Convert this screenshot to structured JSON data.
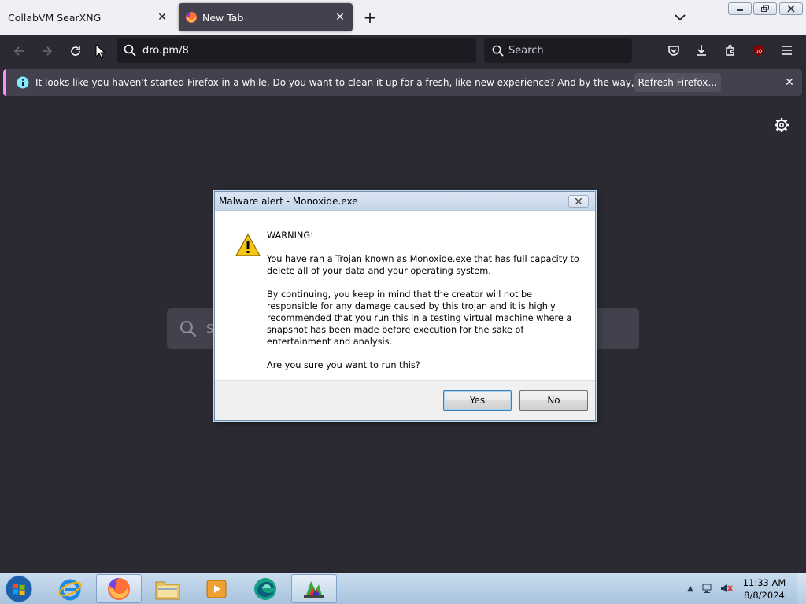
{
  "browser": {
    "tabs": [
      {
        "label": "CollabVM SearXNG",
        "active": false
      },
      {
        "label": "New Tab",
        "active": true
      }
    ],
    "url": "dro.pm/8",
    "search_placeholder": "Search",
    "notification": {
      "message": "It looks like you haven't started Firefox in a while. Do you want to clean it up for a fresh, like-new experience? And by the way, welcome back!",
      "button": "Refresh Firefox…"
    },
    "newtab_search_placeholder": "S"
  },
  "dialog": {
    "title": "Malware alert - Monoxide.exe",
    "heading": "WARNING!",
    "para1": "You have ran a Trojan known as Monoxide.exe that has full capacity to delete all of your data and your operating system.",
    "para2": "By continuing, you keep in mind that the creator will not be responsible for any damage caused by this trojan and it is highly recommended that you run this in a testing virtual machine where a snapshot has been made before execution for the sake of entertainment and analysis.",
    "question": "Are you sure you want to run this?",
    "yes_label": "Yes",
    "no_label": "No"
  },
  "taskbar": {
    "items": [
      "internet-explorer",
      "firefox",
      "file-explorer",
      "media-player",
      "edge-browser",
      "monoxide-app"
    ],
    "time": "11:33 AM",
    "date": "8/8/2024"
  },
  "colors": {
    "browser_bg": "#2b2a33",
    "tab_active": "#42414d",
    "url_bg": "#1c1b22",
    "notification_accent": "#ff8ef4"
  }
}
